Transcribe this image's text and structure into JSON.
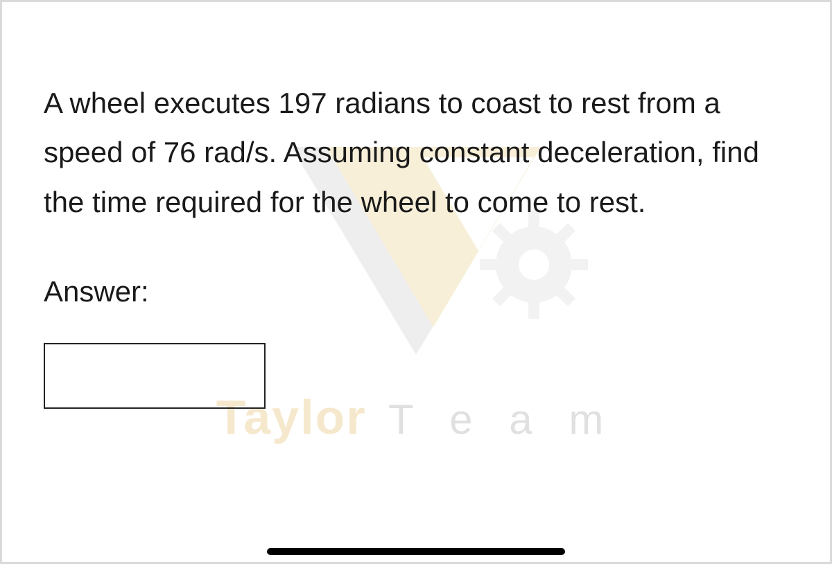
{
  "question": "A wheel executes 197 radians to coast to rest from a speed of 76 rad/s. Assuming constant deceleration, find the time required for the wheel to come to rest.",
  "answer_label": "Answer:",
  "answer_value": "",
  "watermark": {
    "brand": "Taylor",
    "sub": "T e a m"
  }
}
